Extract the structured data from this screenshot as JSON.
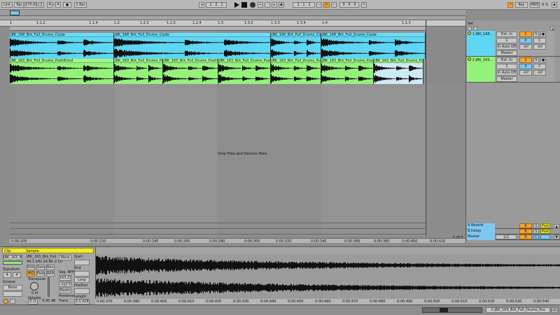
{
  "transport": {
    "link": "Link",
    "tap": "Tap",
    "tempo": "170.00",
    "sig_num": "4",
    "sig_den": "4",
    "metronome": "●",
    "quant": "1 Bar",
    "position": "1 . 2 . 1",
    "loop_start": "1 . 1 . 1",
    "loop_len": "0 . 0 . 0",
    "key": "Key",
    "midi": "MIDI",
    "pct": "0 %"
  },
  "ruler": {
    "ticks": [
      "1.1.2",
      "1.1.3",
      "1.1.4",
      "1.2",
      "1.2.2",
      "1.2.3",
      "1.2.4",
      "1.3",
      "1.3.2",
      "1.3.3",
      "1.3.4",
      "1.4"
    ],
    "set": "Set"
  },
  "tracks": [
    {
      "name": "1 JBK_168...",
      "color": "#5fd6f3",
      "input": "Ext. In",
      "input_ch": "1",
      "monitor": "In Auto Off",
      "output": "Master",
      "volume": "0",
      "pan": "C",
      "sends": [
        "-inf",
        "-inf"
      ],
      "clips": [
        {
          "label": "JBK_168_Brk_Full_Drums_Clyde"
        },
        {
          "label": "JBK_168_Brk_Full_Drums_Clyde"
        },
        {
          "label": "JBK_168_Brk_Full_Drums_Clyde"
        },
        {
          "label": "JBK_168_Brk_Full_Drums_Clyde"
        }
      ]
    },
    {
      "name": "2 JBK_163...",
      "color": "#94f27a",
      "input": "Ext. In",
      "input_ch": "1",
      "monitor": "In Auto Off",
      "output": "Master",
      "volume": "0",
      "pan": "C",
      "sends": [
        "-inf",
        "-inf"
      ],
      "clips": [
        {
          "label": "JBK_163_Brk_Full_Drums_PushItUnd"
        },
        {
          "label": "JBK_163_Brk_Full_Drums_PushItUnd"
        },
        {
          "label": "JBK_163_Brk_Full_Drums_PushItUnd"
        },
        {
          "label": "JBK_163_Brk_Full_Drums_PushItUnd"
        },
        {
          "label": "JBK_163_Brk_Full_Drums_PushItUnd"
        },
        {
          "label": "JBK_163_Brk_Full_Drums_PushItUnd"
        },
        {
          "label": "JBK_163_Brk_Full_Drums_PushItUnd"
        }
      ]
    }
  ],
  "drop_hint": "Drop Files and Devices Here",
  "returns": [
    {
      "name": "A Reverb",
      "letter": "A",
      "color": "#7ec8f0"
    },
    {
      "name": "B Delay",
      "letter": "B",
      "color": "#7ec8f0"
    },
    {
      "name": "Master",
      "letter": "",
      "color": "#7ec8f0",
      "io": "1/2",
      "vol": "0"
    }
  ],
  "zoom": "1/32",
  "bottom_ruler": [
    "0:00:200",
    "0:00:220",
    "0:00:240",
    "0:00:260",
    "0:00:280",
    "0:00:300",
    "0:00:320",
    "0:00:340",
    "0:00:360",
    "0:00:380",
    "0:00:400",
    "0:00:420",
    "0:00:440"
  ],
  "clip_view": {
    "clip_tab": "Clip",
    "sample_tab": "Sample",
    "clip_name": "JBK_163_Br",
    "sample_name": "JBK_163_Brk_Full",
    "sample_info": "44.1 kHz 24 Bit 2 Ch",
    "edit": "Edit",
    "save": "Save",
    "rev": "Rev.",
    "hiq": "HiQ",
    "fade": "Fade",
    "ram": "RAM",
    "signature": "Signature",
    "sig_num": "4",
    "sig_den": "4",
    "groove": "Groove",
    "groove_none": "None",
    "transpose": "Transpose",
    "transpose_val": "0 st",
    "detune": "0 ct",
    "volume": "Volume",
    "volume_val": "0.00 dB",
    "warp": "Warp",
    "seg_bpm": "Seg. BPM",
    "seg_bpm_val": "163.21",
    "beats": "Beats",
    "preserve": "Preserve",
    "trans": "Trans",
    "start": "Start",
    "end": "End",
    "loop": "Loop",
    "position": "Position",
    "length": "Length",
    "length_val": "0.3.428"
  },
  "wave_ticks": [
    "0:00:370",
    "0:00:380",
    "0:00:400",
    "0:00:410",
    "0:00:420",
    "0:00:430",
    "0:00:440",
    "0:00:450",
    "0:00:460",
    "0:00:470",
    "0:00:480",
    "0:00:490",
    "0:00:500",
    "0:00:510",
    "0:00:520",
    "0:00:530",
    "0:00:540"
  ],
  "status": "2-JBK_163_Brk_Full_Drums_Pus"
}
